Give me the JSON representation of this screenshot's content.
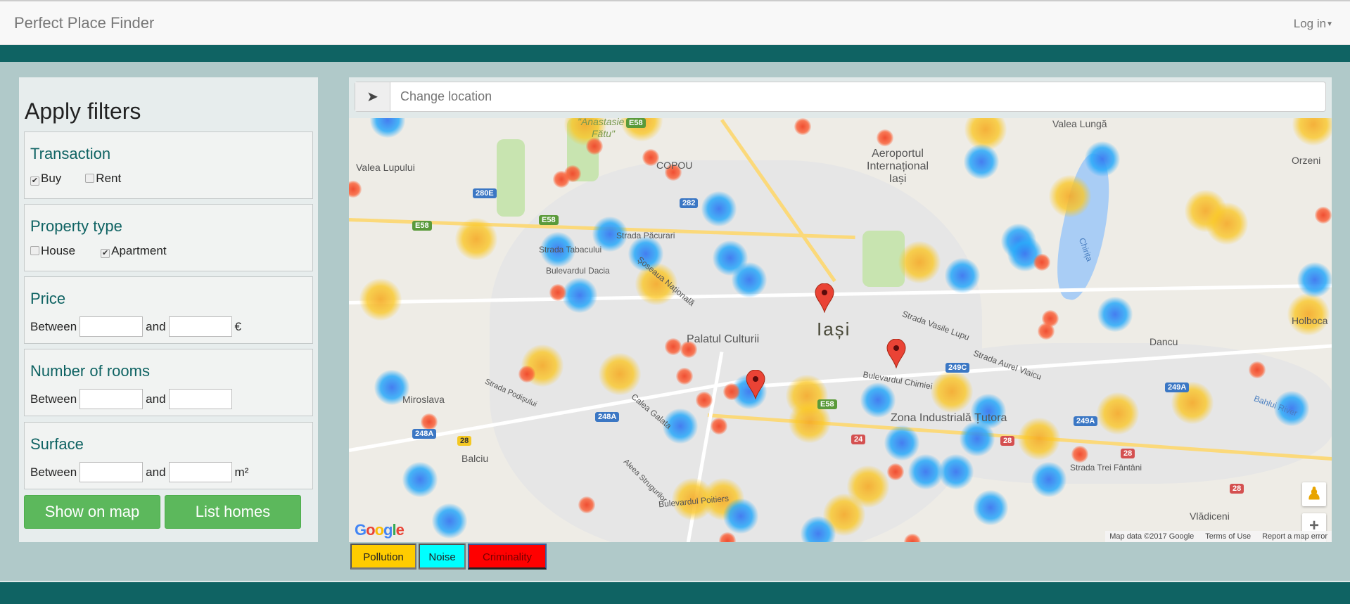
{
  "navbar": {
    "brand": "Perfect Place Finder",
    "login": "Log in"
  },
  "filters": {
    "title": "Apply filters",
    "transaction": {
      "title": "Transaction",
      "options": [
        {
          "label": "Buy",
          "checked": true
        },
        {
          "label": "Rent",
          "checked": false
        }
      ]
    },
    "property_type": {
      "title": "Property type",
      "options": [
        {
          "label": "House",
          "checked": false
        },
        {
          "label": "Apartment",
          "checked": true
        }
      ]
    },
    "price": {
      "title": "Price",
      "between": "Between",
      "and": "and",
      "unit": "€",
      "min": "",
      "max": ""
    },
    "rooms": {
      "title": "Number of rooms",
      "between": "Between",
      "and": "and",
      "min": "",
      "max": ""
    },
    "surface": {
      "title": "Surface",
      "between": "Between",
      "and": "and",
      "unit": "m²",
      "min": "",
      "max": ""
    },
    "show_on_map": "Show on map",
    "list_homes": "List homes"
  },
  "location": {
    "icon": "location-arrow-icon",
    "placeholder": "Change location",
    "value": ""
  },
  "map": {
    "labels": {
      "iasi": "Iași",
      "palatul": "Palatul Culturii",
      "airport1": "Aeroportul",
      "airport2": "Internațional",
      "airport3": "Iași",
      "copou": "COPOU",
      "miroslava": "Miroslava",
      "balciu": "Balciu",
      "tutora": "Zona Industrială Țutora",
      "dancu": "Dancu",
      "holboca": "Holboca",
      "orzeni": "Orzeni",
      "valea_lunga": "Valea Lungă",
      "vladiceni": "Vlădiceni",
      "lupului": "Valea Lupului",
      "fatu1": "\"Anastasie",
      "fatu2": "Fătu\"",
      "dacia": "Bulevardul Dacia",
      "chimiei": "Bulevardul Chimiei",
      "vasile_lupu": "Strada Vasile Lupu",
      "aurel_vlaicu": "Strada Aurel Vlaicu",
      "trei_fantani": "Strada Trei Fântâni",
      "poitiers": "Bulevardul Poitiers",
      "galata": "Calea Galata",
      "pacurari": "Strada Păcurari",
      "tabacului": "Strada Tabacului",
      "nationala": "Șoseaua Națională",
      "bahlui": "Bahlui River",
      "chirita": "Chirița",
      "podisului": "Strada Podișului",
      "strugurilor": "Aleea Strugurilor"
    },
    "shields": [
      "E58",
      "280E",
      "282",
      "E58",
      "E58",
      "248A",
      "28",
      "248A",
      "E58",
      "24",
      "28",
      "249C",
      "249A",
      "249A",
      "28",
      "28"
    ],
    "attribution": "Map data ©2017 Google",
    "terms": "Terms of Use",
    "report": "Report a map error",
    "logo": "Google",
    "zoom_in": "+",
    "zoom_out": "−"
  },
  "layers": [
    {
      "label": "Pollution",
      "color": "#ffcc00"
    },
    {
      "label": "Noise",
      "color": "#00ffff"
    },
    {
      "label": "Criminality",
      "color": "#ff0000",
      "active": true
    }
  ]
}
